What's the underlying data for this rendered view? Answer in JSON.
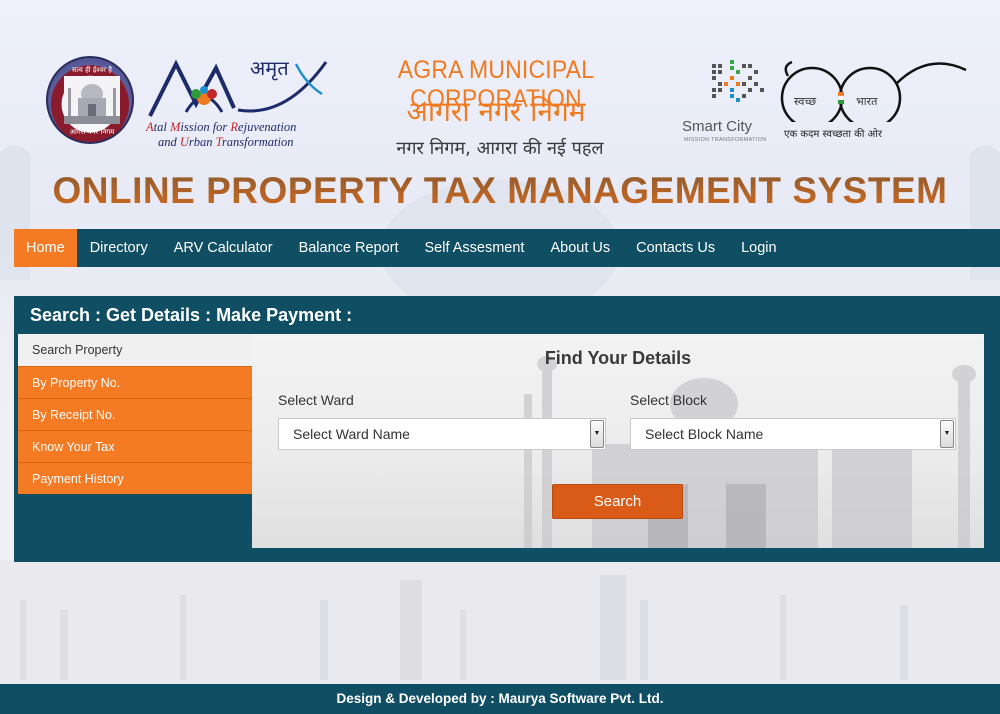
{
  "header": {
    "seal": {
      "top_text": "सत्य ही ईश्वर है",
      "bottom_text": "आगरा नगर निगम"
    },
    "amrut": {
      "hindi": "अमृत",
      "line1_parts": [
        "A",
        "tal ",
        "M",
        "ission for ",
        "R",
        "ejuvenation"
      ],
      "line2_parts": [
        "and ",
        "U",
        "rban ",
        "T",
        "ransformation"
      ]
    },
    "corp_name_en": "AGRA MUNICIPAL CORPORATION",
    "corp_name_hi": "आगरा नगर निगम",
    "corp_tagline": "नगर निगम, आगरा की नई पहल",
    "smart_city": {
      "name": "Smart City",
      "tagline": "MISSION TRANSFORMATION"
    },
    "swachh": {
      "word1": "स्वच्छ",
      "word2": "भारत",
      "tagline": "एक कदम स्वच्छता की ओर"
    },
    "site_title": "ONLINE PROPERTY TAX MANAGEMENT SYSTEM"
  },
  "nav": {
    "items": [
      {
        "label": "Home",
        "active": true
      },
      {
        "label": "Directory"
      },
      {
        "label": "ARV Calculator"
      },
      {
        "label": "Balance Report"
      },
      {
        "label": "Self Assesment"
      },
      {
        "label": "About Us"
      },
      {
        "label": "Contacts Us"
      },
      {
        "label": "Login"
      }
    ]
  },
  "panel": {
    "title": "Search : Get Details : Make Payment :",
    "side_heading": "Search Property",
    "side_items": [
      "By Property No.",
      "By Receipt No.",
      "Know Your Tax",
      "Payment History"
    ],
    "content_title": "Find Your Details",
    "ward_label": "Select Ward",
    "ward_selected": "Select Ward Name",
    "block_label": "Select Block",
    "block_selected": "Select Block Name",
    "search_button": "Search"
  },
  "footer": {
    "text": "Design & Developed by : Maurya Software Pvt. Ltd."
  },
  "colors": {
    "nav_bg": "#0f4e63",
    "accent_orange": "#f57a24",
    "button_orange": "#d95b17",
    "title_orange": "#f07a20"
  }
}
